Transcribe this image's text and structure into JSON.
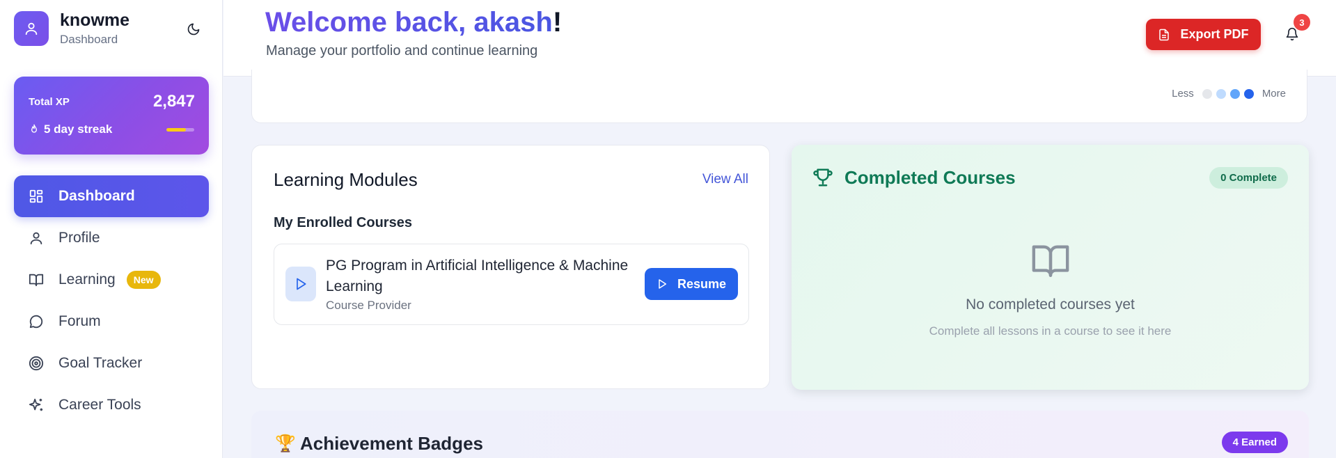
{
  "brand": {
    "name": "knowme",
    "subtitle": "Dashboard"
  },
  "xp": {
    "label": "Total XP",
    "value": "2,847",
    "streak": "5 day streak",
    "streak_progress": 0.7
  },
  "nav": [
    {
      "label": "Dashboard",
      "icon": "grid-icon",
      "active": true
    },
    {
      "label": "Profile",
      "icon": "user-icon"
    },
    {
      "label": "Learning",
      "icon": "book-icon",
      "badge": "New"
    },
    {
      "label": "Forum",
      "icon": "chat-icon"
    },
    {
      "label": "Goal Tracker",
      "icon": "target-icon"
    },
    {
      "label": "Career Tools",
      "icon": "sparkles-icon"
    }
  ],
  "header": {
    "welcome_prefix": "Welcome back, akash",
    "welcome_suffix": "!",
    "subtitle": "Manage your portfolio and continue learning",
    "export_label": "Export PDF",
    "notification_count": "3"
  },
  "heatmap_legend": {
    "less": "Less",
    "more": "More",
    "colors": [
      "#e5e7eb",
      "#bfdbfe",
      "#60a5fa",
      "#2563eb"
    ]
  },
  "modules": {
    "title": "Learning Modules",
    "view_all": "View All",
    "section": "My Enrolled Courses",
    "course": {
      "title": "PG Program in Artificial Intelligence & Machine Learning",
      "provider": "Course Provider",
      "action": "Resume"
    }
  },
  "completed": {
    "title": "Completed Courses",
    "badge": "0 Complete",
    "empty_title": "No completed courses yet",
    "empty_sub": "Complete all lessons in a course to see it here"
  },
  "achievements": {
    "title": "Achievement Badges",
    "earned": "4 Earned"
  },
  "colors": {
    "primary": "#4f58e6",
    "accent_purple": "#7c3aed",
    "danger": "#dc2626",
    "success": "#0f7a56",
    "blue": "#2563eb"
  }
}
